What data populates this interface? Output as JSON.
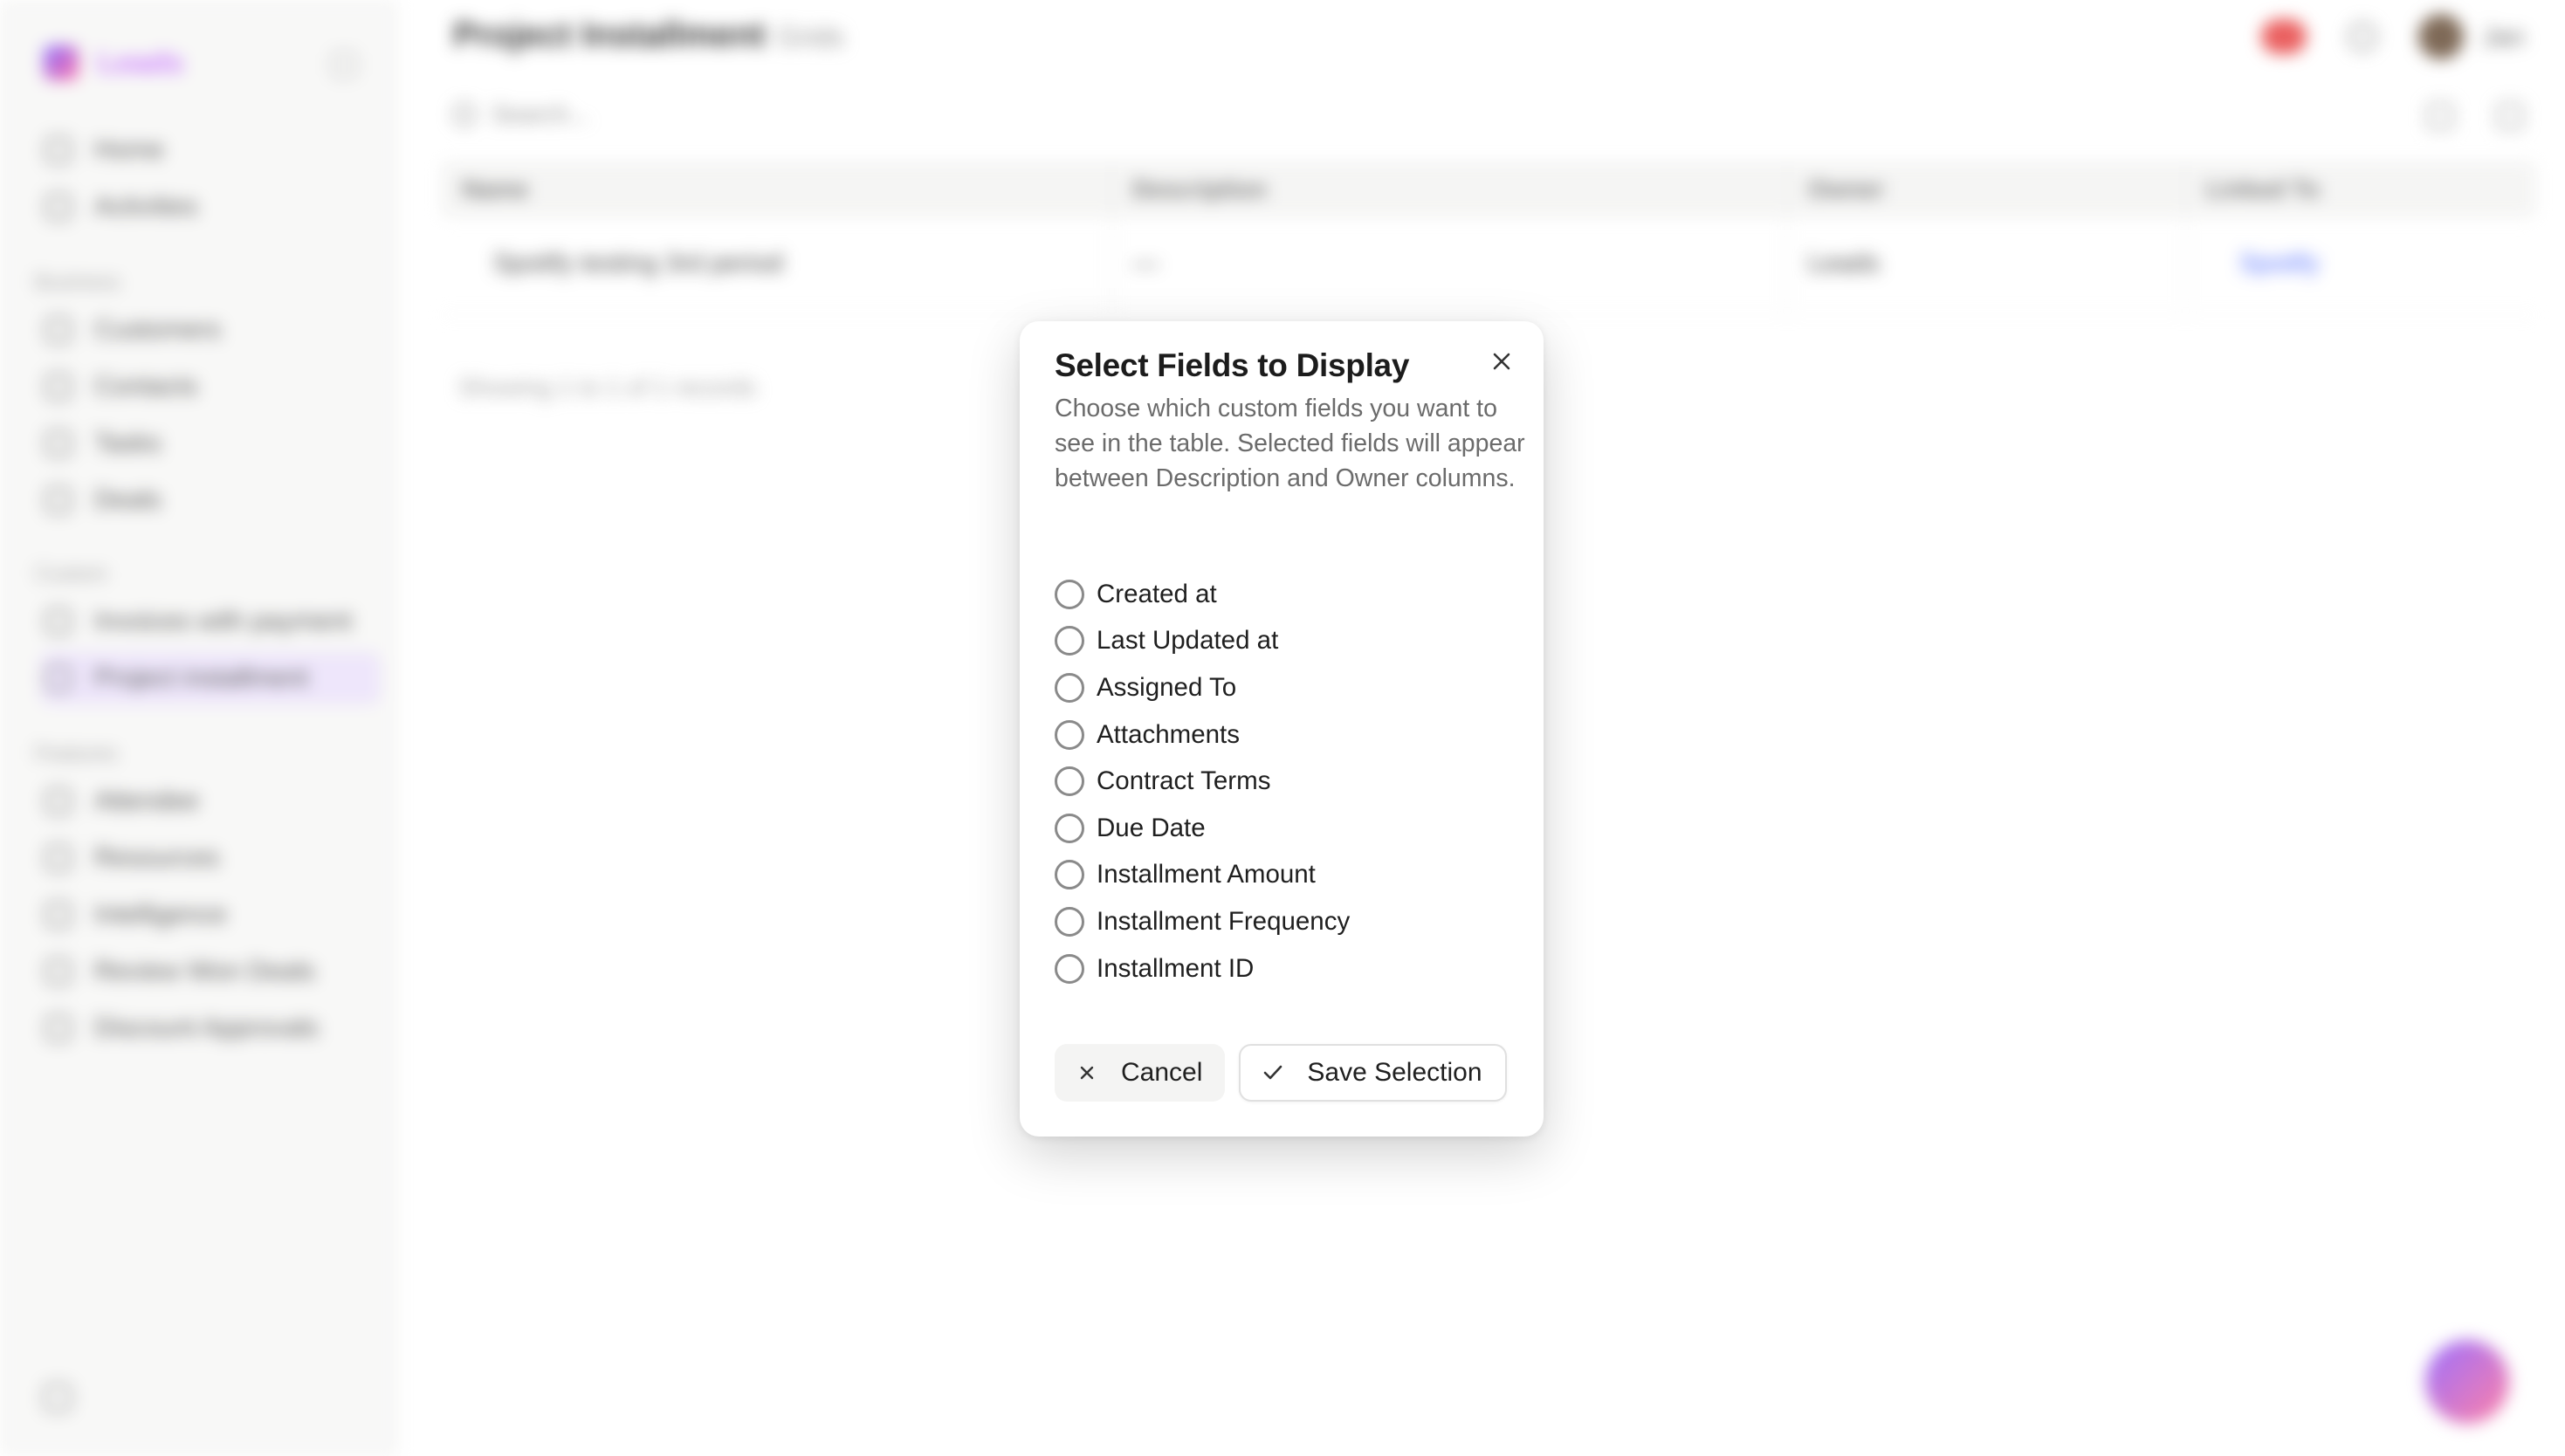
{
  "background": {
    "brand_name": "Leads",
    "side_groups": [
      "Business",
      "Custom",
      "Features"
    ],
    "side_items": [
      {
        "label": "Home"
      },
      {
        "label": "Activities"
      },
      {
        "label": "Customers"
      },
      {
        "label": "Contacts"
      },
      {
        "label": "Tasks"
      },
      {
        "label": "Deals"
      },
      {
        "label": "Invoices with payment"
      },
      {
        "label": "Project installment"
      },
      {
        "label": "Attendee"
      },
      {
        "label": "Resources"
      },
      {
        "label": "Intelligence"
      },
      {
        "label": "Review Won Deals"
      },
      {
        "label": "Discount Approvals"
      }
    ],
    "page_title": "Project Installment",
    "breadcrumb": "Grids",
    "user_name": "Jan",
    "search_placeholder": "Search...",
    "table": {
      "columns": [
        "Name",
        "Description",
        "Owner",
        "Linked To"
      ],
      "rows": [
        {
          "name": "Spotify testing 3rd period",
          "description": "—",
          "owner": "Leads",
          "linked": "Spotify"
        }
      ]
    },
    "footer_count": "Showing 1 to 1 of 1 records",
    "colors": {
      "accent": "#c56cff",
      "badge_red": "#e84a4a"
    }
  },
  "dialog": {
    "title": "Select Fields to Display",
    "description": "Choose which custom fields you want to see in the table. Selected fields will appear between Description and Owner columns.",
    "fields": [
      {
        "label": "Created at",
        "checked": false
      },
      {
        "label": "Last Updated at",
        "checked": false
      },
      {
        "label": "Assigned To",
        "checked": false
      },
      {
        "label": "Attachments",
        "checked": false
      },
      {
        "label": "Contract Terms",
        "checked": false
      },
      {
        "label": "Due Date",
        "checked": false
      },
      {
        "label": "Installment Amount",
        "checked": false
      },
      {
        "label": "Installment Frequency",
        "checked": false
      },
      {
        "label": "Installment ID",
        "checked": false
      }
    ],
    "cancel_label": "Cancel",
    "save_label": "Save Selection",
    "icons": {
      "close": "close-icon",
      "cancel": "x-icon",
      "save": "check-icon"
    }
  }
}
